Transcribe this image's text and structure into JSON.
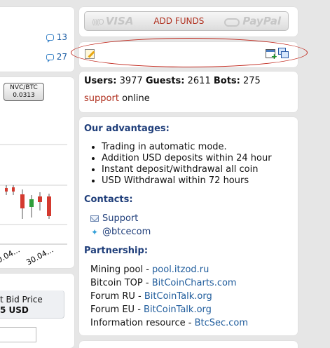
{
  "left_panel": {
    "comments": [
      {
        "count": "13"
      },
      {
        "count": "27"
      }
    ],
    "pair_badge": {
      "pair": "NVC/BTC",
      "rate": "0.0313"
    },
    "chart_dates": [
      "30.04...",
      "30.04..."
    ],
    "bid": {
      "label": "t Bid Price",
      "value": "5 USD"
    }
  },
  "funds": {
    "card_logo": "VISA",
    "button_label": "ADD FUNDS",
    "paypal_logo": "PayPal"
  },
  "stats": {
    "users_label": "Users:",
    "users_value": "3977",
    "guests_label": "Guests:",
    "guests_value": "2611",
    "bots_label": "Bots:",
    "bots_value": "275",
    "support_link": "support",
    "support_status": "online"
  },
  "advantages": {
    "title": "Our advantages:",
    "items": [
      "Trading in automatic mode.",
      "Addition USD deposits within 24 hour",
      "Instant deposit/withdrawal all coin",
      "USD Withdrawal within 72 hours"
    ]
  },
  "contacts": {
    "title": "Contacts:",
    "support": "Support",
    "twitter": "@btcecom"
  },
  "partnership": {
    "title": "Partnership:",
    "rows": [
      {
        "label": "Mining pool - ",
        "link": "pool.itzod.ru"
      },
      {
        "label": "Bitcoin TOP - ",
        "link": "BitCoinCharts.com"
      },
      {
        "label": "Forum RU - ",
        "link": "BitCoinTalk.org"
      },
      {
        "label": "Forum EU - ",
        "link": "BitCoinTalk.org"
      },
      {
        "label": "Information resource - ",
        "link": "BtcSec.com"
      }
    ]
  },
  "colors": {
    "accent_red": "#b0301f",
    "heading_blue": "#1f3e7a",
    "link_blue": "#1f5c9c",
    "candle_red": "#d43a2f",
    "candle_green": "#2f9e3a"
  }
}
